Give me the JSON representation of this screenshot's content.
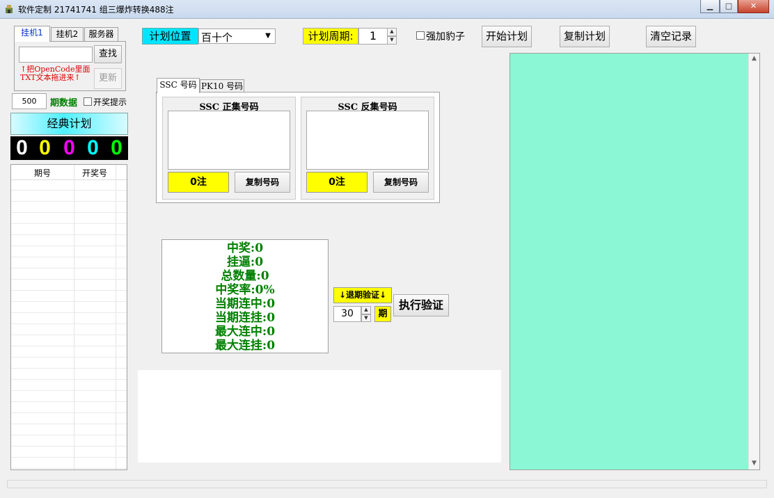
{
  "window": {
    "title": "软件定制 21741741 组三爆炸转换488注",
    "min_label": "▁",
    "max_label": "□",
    "close_label": "✕"
  },
  "left": {
    "tabs": [
      "挂机1",
      "挂机2",
      "服务器"
    ],
    "search_input": "",
    "search_button": "查找",
    "update_button": "更新",
    "hint_line1": "↑把OpenCode里面",
    "hint_line2": "TXT文本拖进来↑",
    "period_count": "500",
    "period_data_label": "期数据",
    "open_prompt_label": "开奖提示",
    "classic_plan_button": "经典计划",
    "digits": [
      "0",
      "0",
      "0",
      "0",
      "0"
    ],
    "digit_colors": [
      "#ffffff",
      "#ffff00",
      "#ff00ff",
      "#00ffff",
      "#00ff00"
    ],
    "table_headers": [
      "期号",
      "开奖号"
    ]
  },
  "toolbar": {
    "plan_position_label": "计划位置",
    "plan_position_value": "百十个",
    "plan_period_label": "计划周期:",
    "plan_period_value": "1",
    "strong_leopard_label": "强加豹子",
    "start_plan_button": "开始计划",
    "copy_plan_button": "复制计划",
    "clear_records_button": "清空记录"
  },
  "code_tabs": [
    "SSC 号码",
    "PK10 号码"
  ],
  "positive_group": {
    "title": "SSC 正集号码",
    "count_label": "0注",
    "copy_button": "复制号码"
  },
  "negative_group": {
    "title": "SSC 反集号码",
    "count_label": "0注",
    "copy_button": "复制号码"
  },
  "stats": [
    "中奖:0",
    "挂逼:0",
    "总数量:0",
    "中奖率:0%",
    "当期连中:0",
    "当期连挂:0",
    "最大连中:0",
    "最大连挂:0"
  ],
  "verify": {
    "backtrack_label": "↓退期验证↓",
    "period_value": "30",
    "period_unit": "期",
    "execute_button": "执行验证"
  },
  "colors": {
    "plan_position_bg": "#00e5ff",
    "yellow": "#ffff00",
    "stats_green": "#008000",
    "output_panel_bg": "#8cf7d4"
  }
}
